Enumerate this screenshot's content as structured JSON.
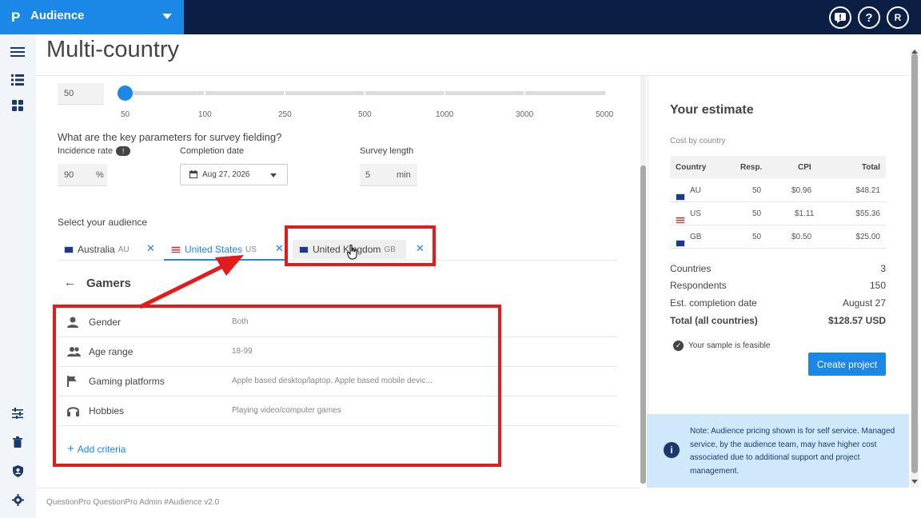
{
  "app": {
    "name": "Audience",
    "logo": "P",
    "avatar_initial": "R"
  },
  "topbar_icons": [
    "alert-icon",
    "help-icon",
    "user-avatar"
  ],
  "page_title": "Multi-country",
  "slider": {
    "value": "50",
    "ticks": [
      "50",
      "100",
      "250",
      "500",
      "1000",
      "3000",
      "5000"
    ],
    "accent": "#1b87e6"
  },
  "fielding": {
    "question": "What are the key parameters for survey fielding?",
    "incidence_label": "Incidence rate",
    "incidence_value": "90",
    "incidence_unit": "%",
    "completion_label": "Completion date",
    "completion_value": "Aug 27, 2026",
    "length_label": "Survey length",
    "length_value": "5",
    "length_unit": "min"
  },
  "audience": {
    "label": "Select your audience",
    "tabs": [
      {
        "name": "Australia",
        "code": "AU"
      },
      {
        "name": "United States",
        "code": "US"
      },
      {
        "name": "United Kingdom",
        "code": "GB"
      }
    ],
    "active_tab": "United States",
    "segment_title": "Gamers",
    "criteria": [
      {
        "label": "Gender",
        "value": "Both",
        "icon": "person-icon"
      },
      {
        "label": "Age range",
        "value": "18-99",
        "icon": "people-icon"
      },
      {
        "label": "Gaming platforms",
        "value": "Apple based desktop/laptop, Apple based mobile devic...",
        "icon": "flag-icon"
      },
      {
        "label": "Hobbies",
        "value": "Playing video/computer games",
        "icon": "headphones-icon"
      }
    ],
    "add_criteria": "Add criteria"
  },
  "estimate": {
    "title": "Your estimate",
    "subtitle": "Cost by country",
    "table_headers": [
      "Country",
      "Resp.",
      "CPI",
      "Total"
    ],
    "rows": [
      {
        "country": "AU",
        "resp": "50",
        "cpi": "$0.96",
        "total": "$48.21"
      },
      {
        "country": "US",
        "resp": "50",
        "cpi": "$1.11",
        "total": "$55.36"
      },
      {
        "country": "GB",
        "resp": "50",
        "cpi": "$0.50",
        "total": "$25.00"
      }
    ],
    "summary": [
      {
        "label": "Countries",
        "value": "3"
      },
      {
        "label": "Respondents",
        "value": "150"
      },
      {
        "label": "Est. completion date",
        "value": "August 27"
      },
      {
        "label": "Total (all countries)",
        "value": "$128.57 USD"
      }
    ],
    "feasible_text": "Your sample is feasible",
    "create_button": "Create project",
    "note": "Note: Audience pricing shown is for self service. Managed service, by the audience team, may have higher cost associated due to additional support and project management."
  },
  "footer": "QuestionPro QuestionPro Admin  #Audience v2.0",
  "colors": {
    "brand": "#1b87e6",
    "topbar": "#0b1e44",
    "annotation": "#e31b1b",
    "note_bg": "#cfe9fb"
  }
}
